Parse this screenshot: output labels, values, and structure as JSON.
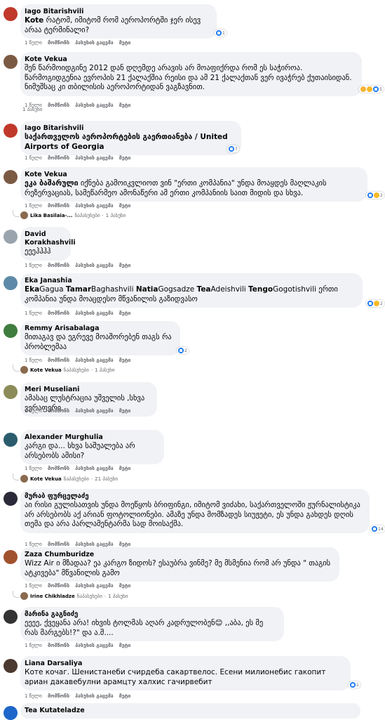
{
  "actions": {
    "like": "მომწონს",
    "reply": "პასუხის გაცემა",
    "more": "მეტი"
  },
  "comments": [
    {
      "author": "Iago Bitarishvili",
      "mention": "Kote",
      "text": " რატომ, იმიტომ რომ აეროპორტში ჯერ ისევ არაა ტერმინალი?",
      "time": "1 წელი",
      "react_count": "1",
      "avatar": "#c0392b"
    },
    {
      "author": "Kote Vekua",
      "mention": "",
      "text": "შენ წარმოიდგინე 2012 დან დღემდე არავის არ მოაფიქრდა რომ ეს საჭიროა. წარმოგიდგენია ევროპის 21 ქალაქშია რეისი და ამ 21 ქალაქთან ვერ ივაჭრებ ქუთაისიდან. ნიმუშსაც კი თბილისის აეროპორტიდან ვაგზავნით.",
      "time": "1 წელი",
      "react_count": "5",
      "avatar": "#7b5a44"
    },
    {
      "author": "Iago Bitarishvili",
      "mention": "საქართველოს აეროპორტების გაერთიანება / United Airports of Georgia",
      "text": "",
      "time": "1 წელი",
      "react_count": "7",
      "avatar": "#c0392b"
    },
    {
      "author": "Kote Vekua",
      "mention": "ეკა ბაშარული",
      "text": " იქნება გამოიკვლიოთ ვინ \"ერთი კომპანია\" უნდა მოაყდეს მაღლაკის რეზერვაციას, სამეწარმეო ამონაწერი ამ ერთი კომპანიის საით მიდის და სხვა.",
      "time": "1 წელი",
      "react_count": "2",
      "avatar": "#7b5a44"
    },
    {
      "author": "David Korakhashvili",
      "mention": "",
      "text": "ეეეჰჰჰჰ",
      "time": "1 წელი",
      "react_count": "",
      "avatar": "#9aa4ad"
    },
    {
      "author": "Eka Janashia",
      "mention": "",
      "text": "",
      "rich": [
        {
          "b": "Eka"
        },
        {
          "t": "Gagua "
        },
        {
          "b": "Tamar"
        },
        {
          "t": "Baghashvili "
        },
        {
          "b": "Natia"
        },
        {
          "t": "Gogsadze "
        },
        {
          "b": "Tea"
        },
        {
          "t": "Adeishvili "
        },
        {
          "b": "Tengo"
        },
        {
          "t": "Gogotishvili ერთი კომპანია უნდა მოაცდესო მწვანილის გაზიდვასო"
        }
      ],
      "time": "1 წელი",
      "react_count": "2",
      "avatar": "#5d8aa8"
    },
    {
      "author": "Remmy Arisabalaga",
      "mention": "",
      "text": "მითაგავ და ეგრევე მოაშორებენ თაგს რა პრობლემაა",
      "time": "1 წელი",
      "react_count": "2",
      "avatar": "#3e7d3e"
    },
    {
      "author": "Meri Museliani",
      "mention": "",
      "text": "ამასაც ლუსტრაცია უშველის ,სხვა ვერაფერი.",
      "time": "1 წელი",
      "react_count": "",
      "avatar": "#8c8c5a"
    },
    {
      "author": "Alexander Murghulia",
      "mention": "",
      "text": "კარგი და... სხვა საშუალება არ არსებობს ამისი?",
      "time": "1 წელი",
      "react_count": "",
      "avatar": "#2b5c6e"
    },
    {
      "author": "მურაბ ფურცელაძე",
      "mention": "",
      "text": "აი რისი გულისათვის უნდა მოეწყოს ბრიფინგი, იმიტომ ვიძახი, საქართველოში ჟურნალისტიკა არ არსებობს აქ არიან ფოტოლიონები. ამაზე უნდა მომზადეს სიუჟეტი, ეს უნდა გახდეს დღის თემა და არა პარლამენტარმა სად მოისაქმა.",
      "time": "1 წელი",
      "react_count": "14",
      "avatar": "#2a2a3a"
    },
    {
      "author": "Zaza Chumburidze",
      "mention": "",
      "text": "Wizz Air ი მზადაა? ეა კარგო ზიდოს? ესაუბრა ვინმე? მე მსმენია რომ არ უნდა \" თაგის ატკივება\" მწვანილის გამო",
      "time": "1 წელი",
      "react_count": "",
      "avatar": "#a0522d"
    },
    {
      "author": "მარინა გაგნიძე",
      "mention": "",
      "text": "ეეეე, ქვეყანა არა! იხვის ტოლმას აღარ კადრულობენ😊 ,,აბა, ეს მე რას მარგებს!?\" და ა.შ....",
      "time": "1 წელი",
      "react_count": "",
      "avatar": "#333333"
    },
    {
      "author": "Liana Darsaliya",
      "mention": "",
      "text": "Коте кочаг. Шенистанеби счирдеба сакартвелос. Есени милионебис гакопит ариан дакавебулни арамцту халхис гачирвебит",
      "time": "1 წელი",
      "react_count": "1",
      "avatar": "#4a3a30"
    },
    {
      "author": "Tea Kutateladze",
      "mention": "",
      "text": "",
      "time": "",
      "react_count": "",
      "avatar": "#1e66c9"
    }
  ],
  "replies": [
    {
      "count": "1 პასუხი"
    },
    {
      "name": "Lika Basilaia-...",
      "label": "ნაპასუხები",
      "count": "1 პასუხი"
    },
    {
      "name": "Kote Vekua",
      "label": "ნაპასუხები",
      "count": "1 პასუხი"
    },
    {
      "name": "Kote Vekua",
      "label": "ნაპასუხები",
      "count": "21 პასუხი"
    },
    {
      "name": "Irine Chikhladze",
      "label": "ნაპასუხები",
      "count": "1 პასუხი"
    }
  ]
}
